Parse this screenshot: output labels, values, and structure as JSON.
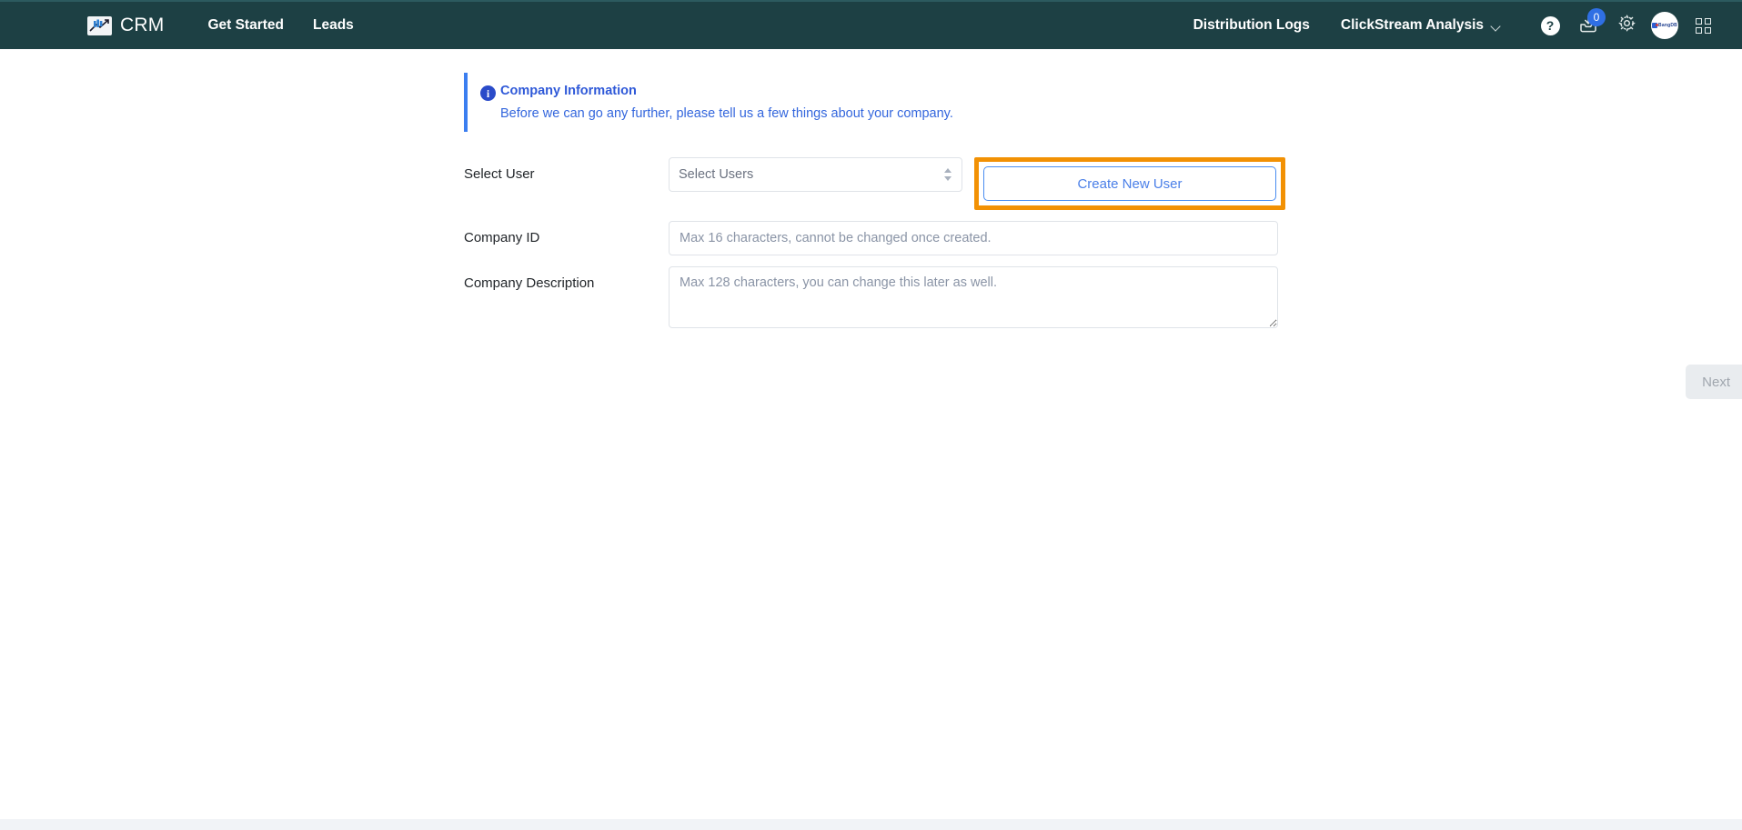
{
  "navbar": {
    "brand": {
      "logo_icon": "chart-arrow-logo-icon",
      "name": "CRM"
    },
    "left_links": [
      {
        "label": "Get Started",
        "name": "nav-link-get-started"
      },
      {
        "label": "Leads",
        "name": "nav-link-leads"
      }
    ],
    "right_links": [
      {
        "label": "Distribution Logs",
        "name": "nav-link-distribution-logs"
      }
    ],
    "dropdown": {
      "label": "ClickStream Analysis",
      "icon": "chevron-down-icon"
    },
    "icons": {
      "help": {
        "glyph": "?",
        "name": "help-icon"
      },
      "inbox": {
        "name": "inbox-download-icon",
        "badge": "0"
      },
      "settings": {
        "name": "gear-icon"
      },
      "apps": {
        "name": "apps-grid-icon"
      }
    },
    "avatar": {
      "name": "avatar",
      "label": "BangDB"
    },
    "bg_color": "#1d4044"
  },
  "alert": {
    "icon": "info-icon",
    "title": "Company Information",
    "text": "Before we can go any further, please tell us a few things about your company.",
    "accent_color": "#3b7ef0",
    "title_color": "#2f59d8"
  },
  "form": {
    "select_user": {
      "label": "Select User",
      "select_value": "Select Users",
      "options": [
        "Select Users"
      ],
      "create_button": "Create New User",
      "highlight_color": "#f29104"
    },
    "company_id": {
      "label": "Company ID",
      "value": "",
      "placeholder": "Max 16 characters, cannot be changed once created."
    },
    "company_description": {
      "label": "Company Description",
      "value": "",
      "placeholder": "Max 128 characters, you can change this later as well."
    },
    "next_button": {
      "label": "Next",
      "disabled": true
    }
  }
}
